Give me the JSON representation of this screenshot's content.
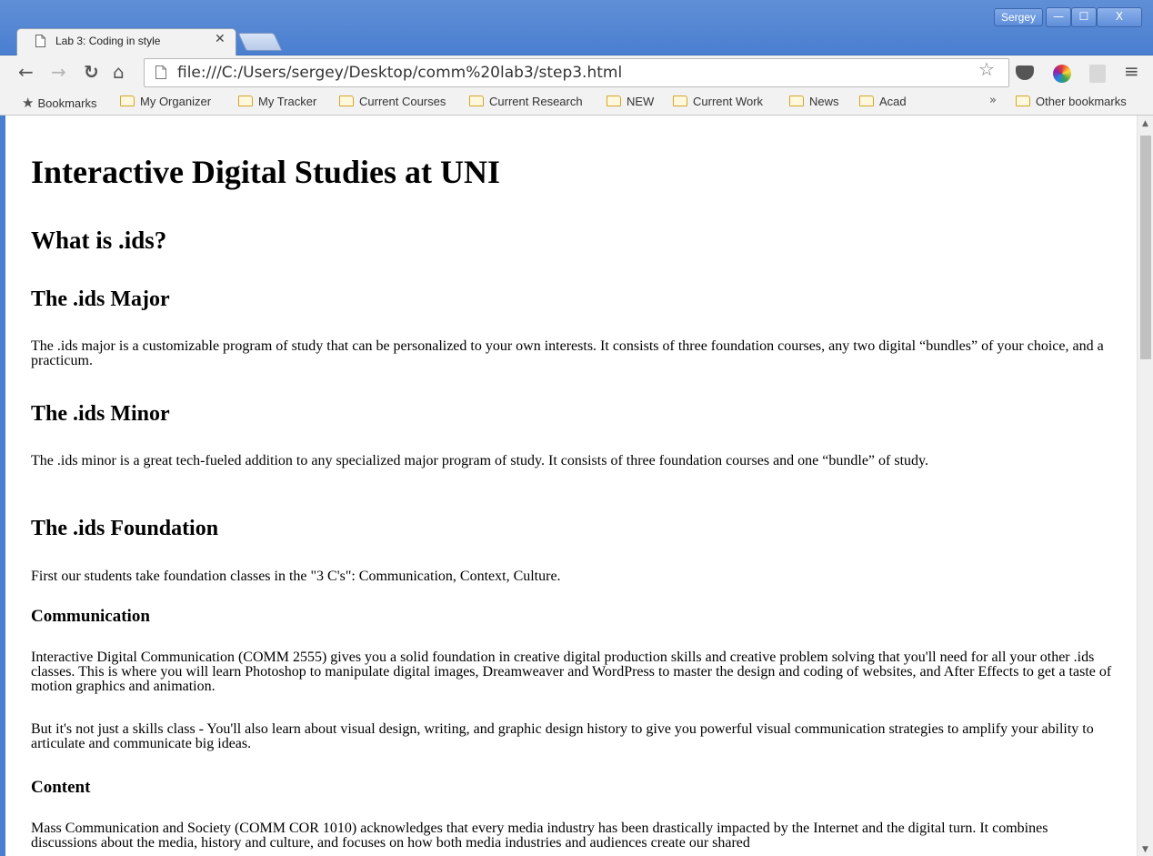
{
  "window": {
    "profile_name": "Sergey",
    "minimize_glyph": "—",
    "maximize_glyph": "☐",
    "close_glyph": "X"
  },
  "tab": {
    "title": "Lab 3: Coding in style",
    "close_glyph": "✕"
  },
  "toolbar": {
    "url": "file:///C:/Users/sergey/Desktop/comm%20lab3/step3.html",
    "icons": [
      "back-icon",
      "forward-icon",
      "reload-icon",
      "home-icon",
      "star-icon",
      "pocket-icon",
      "colorwheel-icon",
      "pdf-icon",
      "menu-icon"
    ]
  },
  "bookmarks": {
    "label": "Bookmarks",
    "folders": [
      "My Organizer",
      "My Tracker",
      "Current Courses",
      "Current Research",
      "NEW",
      "Current Work",
      "News",
      "Acad"
    ],
    "more": "»",
    "other": "Other bookmarks"
  },
  "page": {
    "h1": "Interactive Digital Studies at UNI",
    "what_is": "What is .ids?",
    "major_heading": "The .ids Major",
    "major_text": "The .ids major is a customizable program of study that can be personalized to your own interests. It consists of three foundation courses, any two digital “bundles” of your choice, and a practicum.",
    "minor_heading": "The .ids Minor",
    "minor_text": "The .ids minor is a great tech-fueled addition to any specialized major program of study. It consists of three foundation courses and one “bundle” of study.",
    "foundation_heading": "The .ids Foundation",
    "foundation_text": "First our students take foundation classes in the \"3 C's\": Communication, Context, Culture.",
    "communication_heading": "Communication",
    "communication_text": "Interactive Digital Communication (COMM 2555) gives you a solid foundation in creative digital production skills and creative problem solving that you'll need for all your other .ids classes. This is where you will learn Photoshop to manipulate digital images, Dreamweaver and WordPress to master the design and coding of websites, and After Effects to get a taste of motion graphics and animation.",
    "communication_text_2": "But it's not just a skills class - You'll also learn about visual design, writing, and graphic design history to give you powerful visual communication strategies to amplify your ability to articulate and communicate big ideas.",
    "content_heading": "Content",
    "content_text": "Mass Communication and Society (COMM COR 1010) acknowledges that every media industry has been drastically impacted by the Internet and the digital turn. It combines discussions about the media, history and culture, and focuses on how both media industries and audiences create our shared"
  }
}
